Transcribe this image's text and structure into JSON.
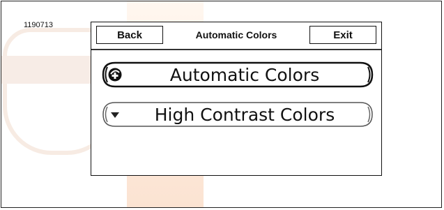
{
  "figure_id": "1190713",
  "header": {
    "back_label": "Back",
    "title": "Automatic Colors",
    "exit_label": "Exit"
  },
  "options": [
    {
      "label": "Automatic Colors",
      "icon": "selected-radio-icon",
      "selected": true
    },
    {
      "label": "High Contrast Colors",
      "icon": "unselected-arrow-icon",
      "selected": false
    }
  ],
  "colors": {
    "ink": "#111111",
    "background": "#ffffff",
    "watermark": "#f7ebe3"
  }
}
